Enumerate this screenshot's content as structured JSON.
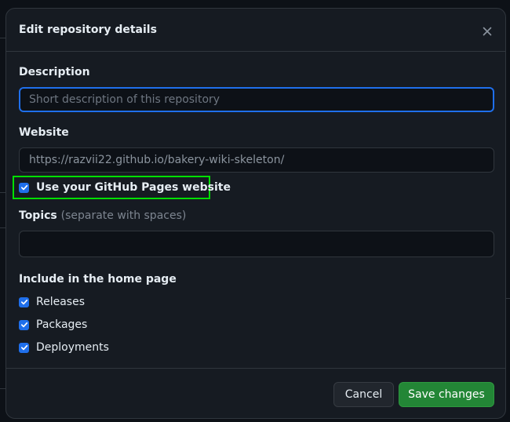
{
  "dialog": {
    "title": "Edit repository details",
    "close_icon": "x-icon"
  },
  "description": {
    "label": "Description",
    "placeholder": "Short description of this repository",
    "value": ""
  },
  "website": {
    "label": "Website",
    "value": "https://razvii22.github.io/bakery-wiki-skeleton/",
    "use_pages_label": "Use your GitHub Pages website",
    "use_pages_checked": true
  },
  "topics": {
    "label": "Topics",
    "hint": "(separate with spaces)",
    "value": ""
  },
  "home_page": {
    "heading": "Include in the home page",
    "options": [
      {
        "label": "Releases",
        "checked": true
      },
      {
        "label": "Packages",
        "checked": true
      },
      {
        "label": "Deployments",
        "checked": true
      }
    ]
  },
  "footer": {
    "cancel_label": "Cancel",
    "save_label": "Save changes"
  },
  "colors": {
    "accent": "#1f6feb",
    "primary_button": "#238636",
    "highlight": "#00e000"
  }
}
